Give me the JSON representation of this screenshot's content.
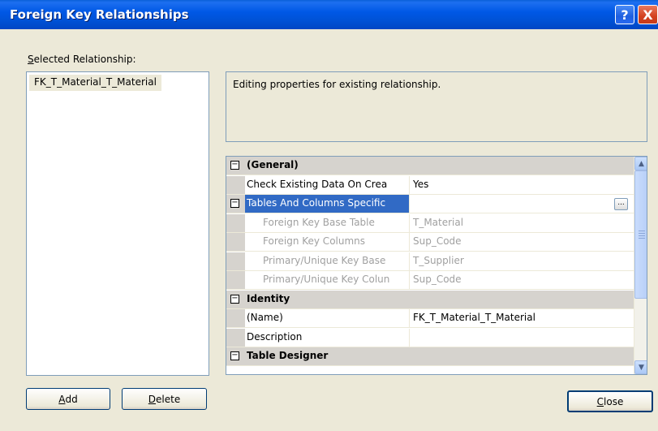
{
  "window": {
    "title": "Foreign Key Relationships"
  },
  "titlebar": {
    "help_glyph": "?",
    "close_glyph": "X"
  },
  "left": {
    "label_first": "S",
    "label_rest": "elected Relationship:",
    "items": [
      "FK_T_Material_T_Material"
    ]
  },
  "info": {
    "text": "Editing properties for existing relationship."
  },
  "grid": {
    "rows": [
      {
        "type": "category",
        "name": "(General)",
        "value": "",
        "expander": "−"
      },
      {
        "type": "property",
        "name": "Check Existing Data On Crea",
        "value": "Yes"
      },
      {
        "type": "selected",
        "name": "Tables And Columns Specific",
        "value": "",
        "expander": "−",
        "button": "..."
      },
      {
        "type": "sub",
        "name": "Foreign Key Base Table",
        "value": "T_Material"
      },
      {
        "type": "sub",
        "name": "Foreign Key Columns",
        "value": "Sup_Code"
      },
      {
        "type": "sub",
        "name": "Primary/Unique Key Base",
        "value": "T_Supplier"
      },
      {
        "type": "sub",
        "name": "Primary/Unique Key Colun",
        "value": "Sup_Code"
      },
      {
        "type": "category",
        "name": "Identity",
        "value": "",
        "expander": "−"
      },
      {
        "type": "property",
        "name": "(Name)",
        "value": "FK_T_Material_T_Material"
      },
      {
        "type": "property",
        "name": "Description",
        "value": ""
      },
      {
        "type": "category",
        "name": "Table Designer",
        "value": "",
        "expander": "−"
      }
    ],
    "scroll_up": "▲",
    "scroll_down": "▼"
  },
  "buttons": {
    "add_first": "A",
    "add_rest": "dd",
    "delete_first": "D",
    "delete_rest": "elete",
    "close_first": "C",
    "close_rest": "lose"
  }
}
